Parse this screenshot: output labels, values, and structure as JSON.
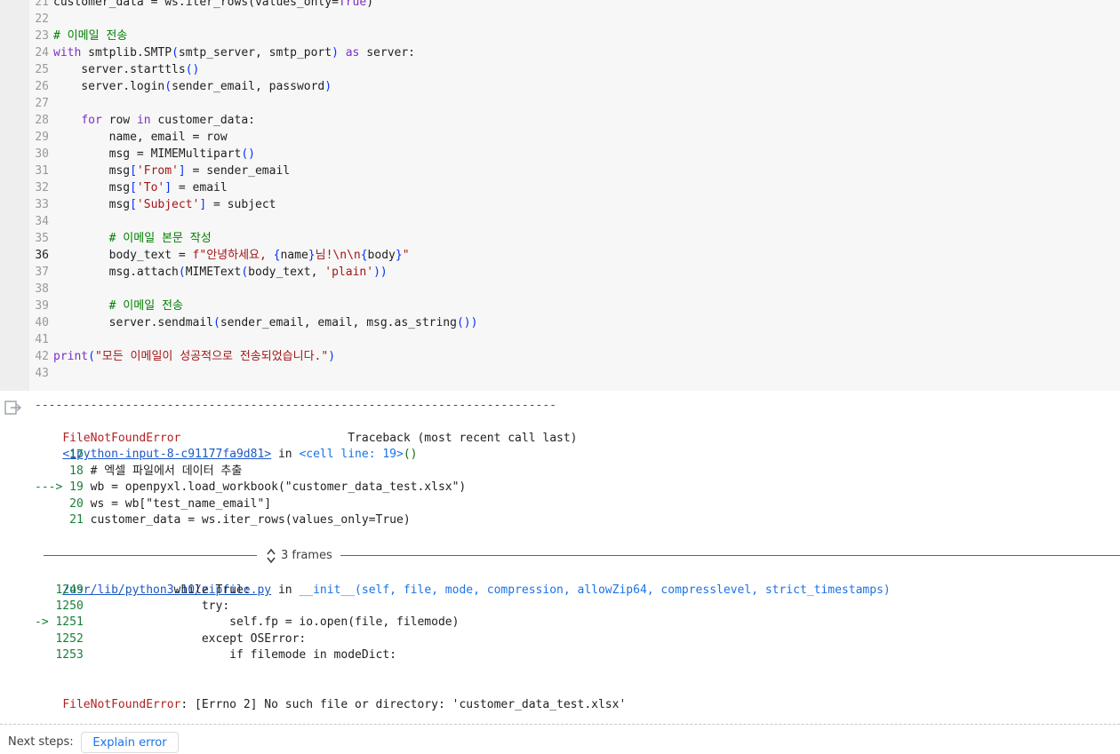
{
  "code": {
    "lines": [
      {
        "n": "21",
        "segs": [
          [
            "customer_data = ws.iter_rows(values_only=",
            ""
          ],
          [
            "True",
            "kw"
          ],
          [
            ")",
            ""
          ]
        ]
      },
      {
        "n": "22",
        "segs": []
      },
      {
        "n": "23",
        "segs": [
          [
            "# 이메일 전송",
            "cm"
          ]
        ]
      },
      {
        "n": "24",
        "segs": [
          [
            "with",
            "kw"
          ],
          [
            " smtplib.SMTP",
            ""
          ],
          [
            "(",
            "br"
          ],
          [
            "smtp_server, smtp_port",
            ""
          ],
          [
            ")",
            "br"
          ],
          [
            " ",
            ""
          ],
          [
            "as",
            "kw"
          ],
          [
            " server:",
            ""
          ]
        ]
      },
      {
        "n": "25",
        "segs": [
          [
            "    server.starttls",
            ""
          ],
          [
            "()",
            "br"
          ]
        ]
      },
      {
        "n": "26",
        "segs": [
          [
            "    server.login",
            ""
          ],
          [
            "(",
            "br"
          ],
          [
            "sender_email, password",
            ""
          ],
          [
            ")",
            "br"
          ]
        ]
      },
      {
        "n": "27",
        "segs": []
      },
      {
        "n": "28",
        "segs": [
          [
            "    ",
            ""
          ],
          [
            "for",
            "kw"
          ],
          [
            " row ",
            ""
          ],
          [
            "in",
            "kw"
          ],
          [
            " customer_data:",
            ""
          ]
        ]
      },
      {
        "n": "29",
        "segs": [
          [
            "        name, email = row",
            ""
          ]
        ]
      },
      {
        "n": "30",
        "segs": [
          [
            "        msg = MIMEMultipart",
            ""
          ],
          [
            "()",
            "br"
          ]
        ]
      },
      {
        "n": "31",
        "segs": [
          [
            "        msg",
            ""
          ],
          [
            "[",
            "br"
          ],
          [
            "'From'",
            "str"
          ],
          [
            "]",
            "br"
          ],
          [
            " = sender_email",
            ""
          ]
        ]
      },
      {
        "n": "32",
        "segs": [
          [
            "        msg",
            ""
          ],
          [
            "[",
            "br"
          ],
          [
            "'To'",
            "str"
          ],
          [
            "]",
            "br"
          ],
          [
            " = email",
            ""
          ]
        ]
      },
      {
        "n": "33",
        "segs": [
          [
            "        msg",
            ""
          ],
          [
            "[",
            "br"
          ],
          [
            "'Subject'",
            "str"
          ],
          [
            "]",
            "br"
          ],
          [
            " = subject",
            ""
          ]
        ]
      },
      {
        "n": "34",
        "segs": []
      },
      {
        "n": "35",
        "segs": [
          [
            "        ",
            ""
          ],
          [
            "# 이메일 본문 작성",
            "cm"
          ]
        ]
      },
      {
        "n": "36",
        "active": true,
        "segs": [
          [
            "        body_text = ",
            ""
          ],
          [
            "f\"안녕하세요, ",
            "str"
          ],
          [
            "{",
            "br"
          ],
          [
            "name",
            ""
          ],
          [
            "}",
            "br"
          ],
          [
            "님!\\n\\n",
            "str"
          ],
          [
            "{",
            "br"
          ],
          [
            "body",
            ""
          ],
          [
            "}",
            "br"
          ],
          [
            "\"",
            "str"
          ]
        ]
      },
      {
        "n": "37",
        "segs": [
          [
            "        msg.attach",
            ""
          ],
          [
            "(",
            "br"
          ],
          [
            "MIMEText",
            ""
          ],
          [
            "(",
            "br"
          ],
          [
            "body_text, ",
            ""
          ],
          [
            "'plain'",
            "str"
          ],
          [
            "))",
            "br"
          ]
        ]
      },
      {
        "n": "38",
        "segs": []
      },
      {
        "n": "39",
        "segs": [
          [
            "        ",
            ""
          ],
          [
            "# 이메일 전송",
            "cm"
          ]
        ]
      },
      {
        "n": "40",
        "segs": [
          [
            "        server.sendmail",
            ""
          ],
          [
            "(",
            "br"
          ],
          [
            "sender_email, email, msg.as_string",
            ""
          ],
          [
            "())",
            "br"
          ]
        ]
      },
      {
        "n": "41",
        "segs": []
      },
      {
        "n": "42",
        "segs": [
          [
            "print",
            "kw"
          ],
          [
            "(",
            "br"
          ],
          [
            "\"모든 이메일이 성공적으로 전송되었습니다.\"",
            "str"
          ],
          [
            ")",
            "br"
          ]
        ]
      },
      {
        "n": "43",
        "segs": []
      }
    ]
  },
  "output": {
    "icon": "output-toggle-icon",
    "dashes": "---------------------------------------------------------------------------",
    "error_name": "FileNotFoundError",
    "traceback_header": "Traceback (most recent call last)",
    "input_link": "<ipython-input-8-c91177fa9d81>",
    "in_word": " in ",
    "cell_ref": "<cell line: 19>",
    "cell_ref_paren": "()",
    "tb_lines": [
      {
        "prefix": "     17",
        "text": ""
      },
      {
        "prefix": "     18",
        "text": " # 엑셀 파일에서 데이터 추출"
      },
      {
        "prefix": "---> 19",
        "text": " wb = openpyxl.load_workbook(\"customer_data_test.xlsx\")"
      },
      {
        "prefix": "     20",
        "text": " ws = wb[\"test_name_email\"]"
      },
      {
        "prefix": "     21",
        "text": " customer_data = ws.iter_rows(values_only=True)"
      }
    ],
    "frames_label": "3 frames",
    "frames_icon": "expand-collapse-icon",
    "zip_link": "/usr/lib/python3.10/zipfile.py",
    "zip_in": " in ",
    "zip_func": "__init__(self, file, mode, compression, allowZip64, compresslevel, strict_timestamps)",
    "zip_lines": [
      {
        "prefix": "   1249",
        "text": "             while True:"
      },
      {
        "prefix": "   1250",
        "text": "                 try:"
      },
      {
        "prefix": "-> 1251",
        "text": "                     self.fp = io.open(file, filemode)"
      },
      {
        "prefix": "   1252",
        "text": "                 except OSError:"
      },
      {
        "prefix": "   1253",
        "text": "                     if filemode in modeDict:"
      }
    ],
    "final_error_msg": ": [Errno 2] No such file or directory: 'customer_data_test.xlsx'"
  },
  "footer": {
    "next_steps_label": "Next steps:",
    "explain_button": "Explain error"
  }
}
